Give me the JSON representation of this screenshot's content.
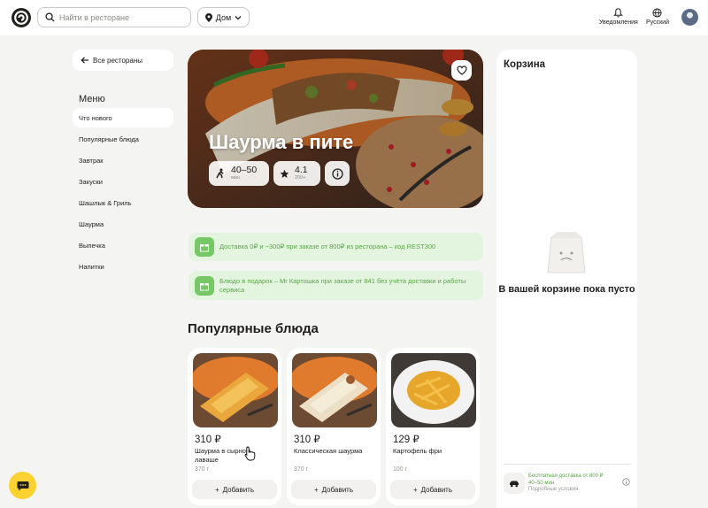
{
  "header": {
    "search_placeholder": "Найти в ресторане",
    "address": "Дом",
    "notifications_label": "Уведомления",
    "language_label": "Русский"
  },
  "sidebar": {
    "back_label": "Все рестораны",
    "menu_title": "Меню",
    "items": [
      {
        "label": "Что нового",
        "active": true
      },
      {
        "label": "Популярные блюда",
        "active": false
      },
      {
        "label": "Завтрак",
        "active": false
      },
      {
        "label": "Закуски",
        "active": false
      },
      {
        "label": "Шашлык & Гриль",
        "active": false
      },
      {
        "label": "Шаурма",
        "active": false
      },
      {
        "label": "Выпечка",
        "active": false
      },
      {
        "label": "Напитки",
        "active": false
      }
    ]
  },
  "hero": {
    "title": "Шаурма в пите",
    "delivery_time": "40–50",
    "delivery_unit": "мин",
    "rating": "4.1",
    "rating_count": "200+"
  },
  "promos": [
    {
      "text": "Доставка 0₽ и −300₽ при заказе от 800₽ из ресторана – код REST300"
    },
    {
      "text": "Блюдо в подарок – Мr Картошка при заказе от 841 без учёта доставки и работы сервиса"
    }
  ],
  "section_title": "Популярные блюда",
  "products": [
    {
      "price": "310 ₽",
      "name": "Шаурма в сырном лаваше",
      "weight": "370 г",
      "add_label": "Добавить"
    },
    {
      "price": "310 ₽",
      "name": "Классическая шаурма",
      "weight": "370 г",
      "add_label": "Добавить"
    },
    {
      "price": "129 ₽",
      "name": "Картофель фри",
      "weight": "100 г",
      "add_label": "Добавить"
    }
  ],
  "cart": {
    "title": "Корзина",
    "empty_text": "В вашей корзине пока пусто",
    "delivery_line1": "Бесплатная доставка от 800 ₽",
    "delivery_line2": "40–50 мин",
    "delivery_line3": "Подробные условия"
  },
  "colors": {
    "accent_yellow": "#fcd230",
    "promo_bg": "#e4f5df",
    "promo_text": "#5aa34a",
    "page_bg": "#f4f4f2"
  }
}
